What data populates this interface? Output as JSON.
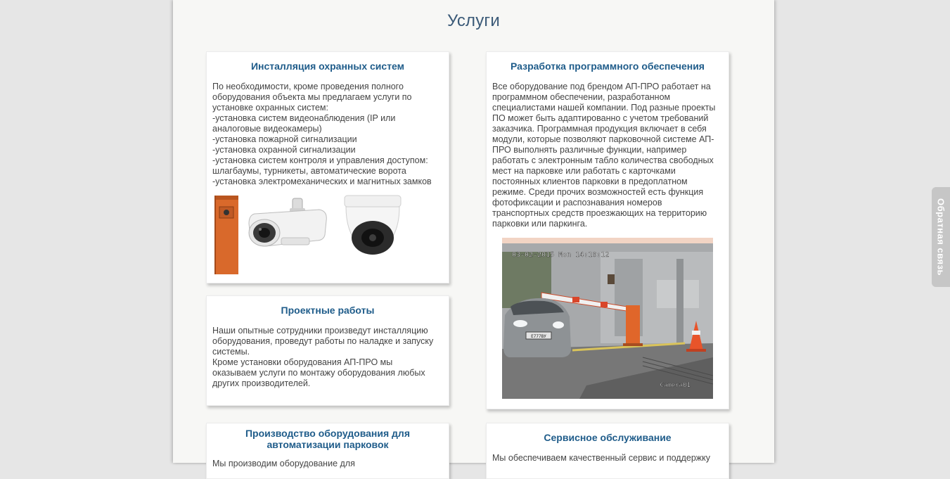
{
  "page": {
    "title": "Услуги"
  },
  "feedback": {
    "label": "Обратная связь"
  },
  "cards": {
    "install": {
      "title": "Инсталляция охранных систем",
      "text": "По необходимости, кроме проведения полного\nоборудования объекта мы предлагаем услуги по\nустановке охранных систем:\n-установка систем видеонаблюдения (IP или\nаналоговые видеокамеры)\n-установка пожарной сигнализации\n-установка охранной сигнализации\n-установка систем контроля и управления доступом:\nшлагбаумы, турникеты, автоматические ворота\n-установка электромеханических и магнитных замков"
    },
    "project": {
      "title": "Проектные работы",
      "text": "Наши опытные сотрудники произведут инсталляцию\nоборудования, проведут работы по наладке и запуску\nсистемы.\nКроме установки оборудования АП-ПРО мы\nоказываем услуги по монтажу оборудования любых\nдругих производителей."
    },
    "production": {
      "title": "Производство оборудования для автоматизации парковок",
      "text": "Мы производим оборудование для"
    },
    "software": {
      "title": "Разработка программного обеспечения",
      "text": "Все оборудование под брендом АП-ПРО работает на\nпрограммном обеспечении, разработанном\nспециалистами нашей компании. Под разные проекты\nПО может быть адаптированно с учетом требований\nзаказчика. Программная продукция включает в себя\nмодули, которые позволяют парковочной системе АП-\nПРО выполнять различные функции, например\nработать с электронным табло количества свободных\nмест на парковке или работать с карточками\nпостоянных клиентов парковки в предоплатном\nрежиме. Среди прочих возможностей есть функция\nфотофиксации и распознавания номеров\nтранспортных средств проезжающих на территорию\nпарковки или паркинга.",
      "cam_timestamp": "03-02-2015 Mon 14:10:12",
      "cam_name": "Camera01",
      "plate": "Е777ВУ"
    },
    "service": {
      "title": "Сервисное обслуживание",
      "text": "Мы обеспечиваем качественный сервис и поддержку"
    }
  },
  "colors": {
    "title": "#3b5a78",
    "card_title": "#1f5c8a",
    "barrier": "#e0662a"
  }
}
